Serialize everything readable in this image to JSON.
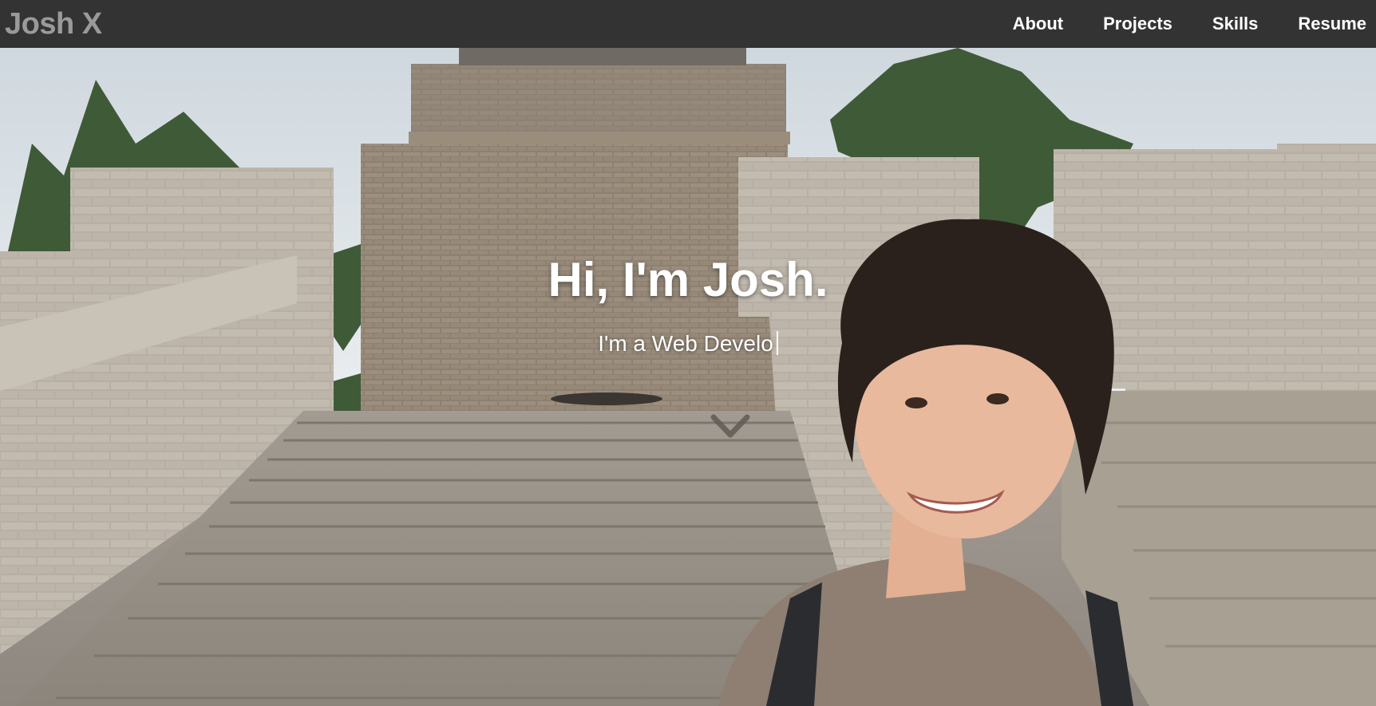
{
  "nav": {
    "brand": "Josh X",
    "links": [
      "About",
      "Projects",
      "Skills",
      "Resume"
    ]
  },
  "hero": {
    "title": "Hi, I'm Josh.",
    "subtitle": "I'm a Web Develo",
    "scroll_icon": "chevron-down-icon",
    "background_image": "portrait in front of the Great Wall staircase"
  },
  "colors": {
    "navbar_bg": "#333333",
    "brand_text": "#9a9a9a",
    "nav_text": "#ffffff",
    "hero_text": "#ffffff"
  }
}
